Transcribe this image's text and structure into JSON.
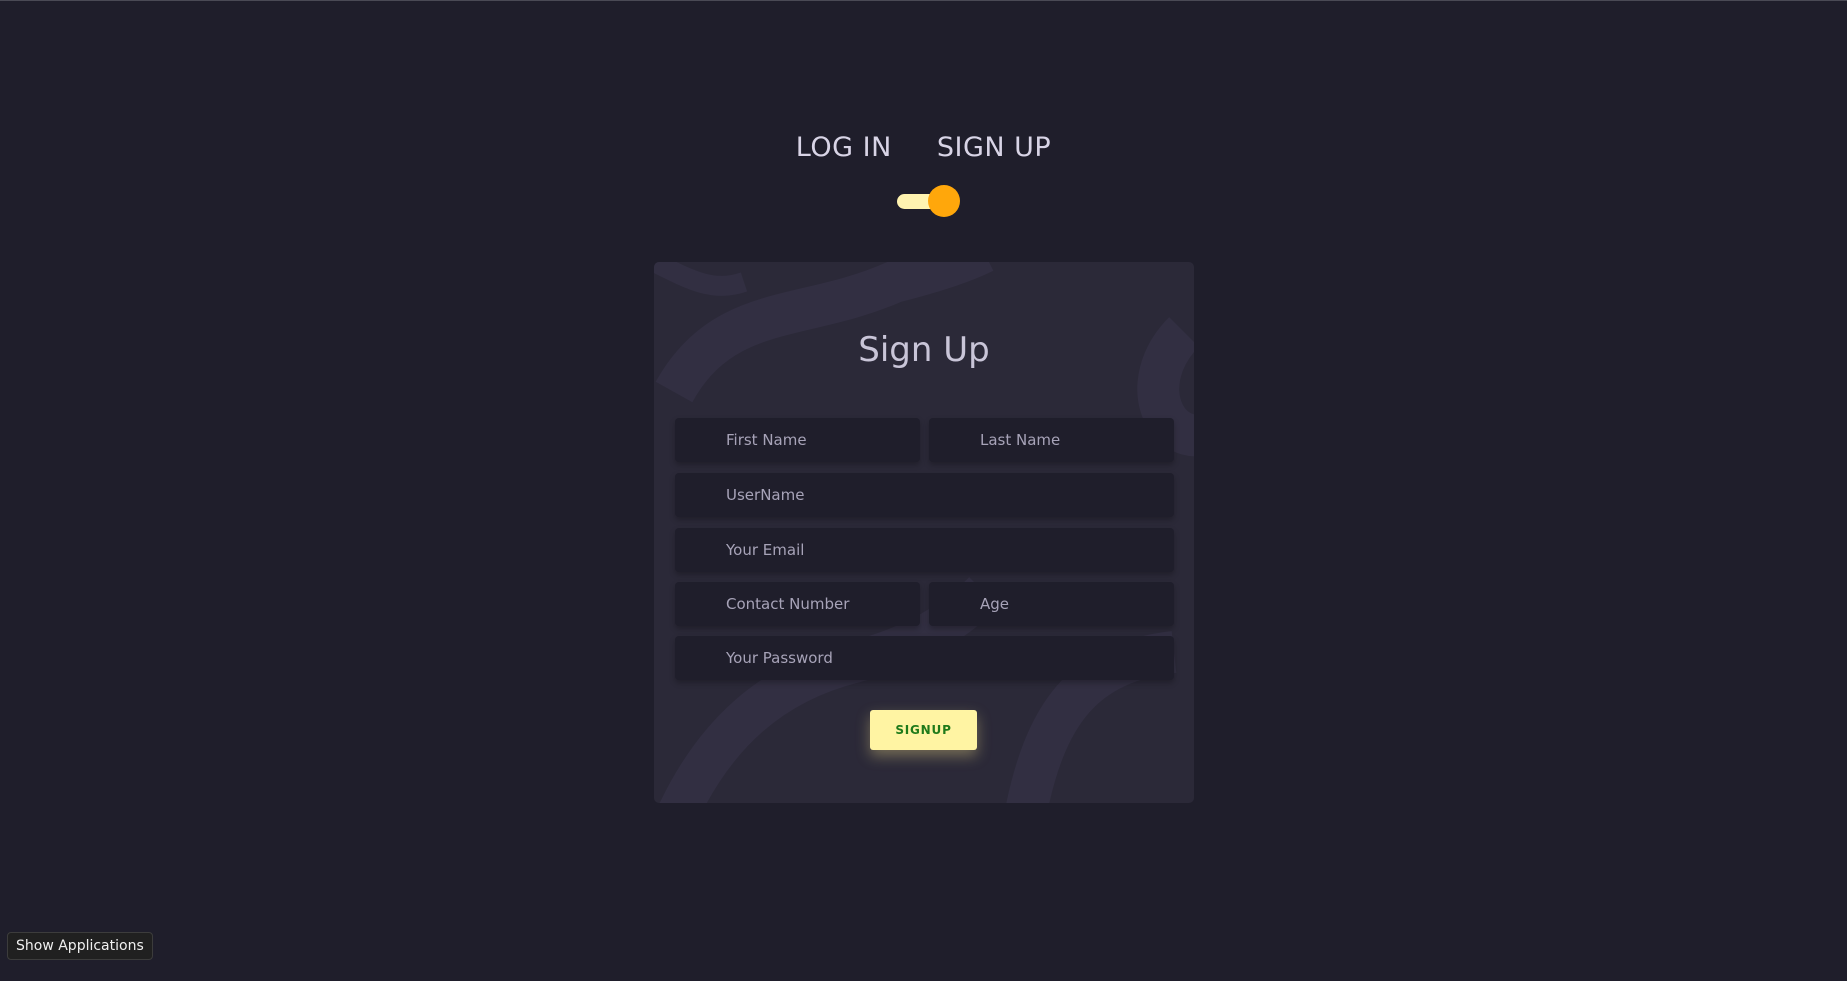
{
  "tabs": {
    "login": "LOG IN",
    "signup": "SIGN UP"
  },
  "form": {
    "title": "Sign Up",
    "first_name_placeholder": "First Name",
    "last_name_placeholder": "Last Name",
    "username_placeholder": "UserName",
    "email_placeholder": "Your Email",
    "contact_placeholder": "Contact Number",
    "age_placeholder": "Age",
    "password_placeholder": "Your Password",
    "submit_label": "SIGNUP"
  },
  "taskbar": {
    "show_apps_label": "Show Applications"
  },
  "colors": {
    "background": "#1f1e2b",
    "card": "#2b2938",
    "toggle_track": "#fff3b0",
    "toggle_knob": "#ffa70b",
    "button": "#fff4a3",
    "button_text": "#1f7a1a"
  }
}
